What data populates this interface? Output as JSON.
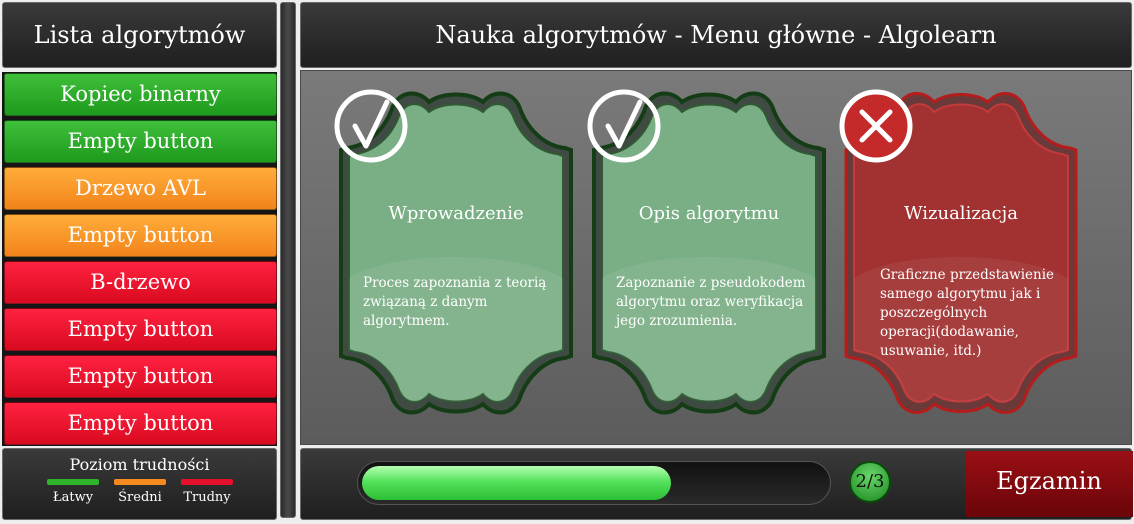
{
  "sidebar": {
    "title": "Lista algorytmów",
    "items": [
      {
        "label": "Kopiec binarny",
        "level": "easy"
      },
      {
        "label": "Empty button",
        "level": "easy"
      },
      {
        "label": "Drzewo AVL",
        "level": "medium"
      },
      {
        "label": "Empty button",
        "level": "medium"
      },
      {
        "label": "B-drzewo",
        "level": "hard"
      },
      {
        "label": "Empty button",
        "level": "hard"
      },
      {
        "label": "Empty button",
        "level": "hard"
      },
      {
        "label": "Empty button",
        "level": "hard"
      }
    ],
    "legend": {
      "title": "Poziom trudności",
      "items": [
        {
          "label": "Łatwy",
          "color": "#2fb52a"
        },
        {
          "label": "Średni",
          "color": "#f58a1f"
        },
        {
          "label": "Trudny",
          "color": "#e5102a"
        }
      ]
    }
  },
  "main": {
    "title": "Nauka algorytmów - Menu główne - Algolearn",
    "cards": [
      {
        "title": "Wprowadzenie",
        "status": "completed",
        "icon": "check-icon",
        "desc_lines": [
          "Proces zapoznania z teorią",
          "związaną z danym",
          "algorytmem."
        ]
      },
      {
        "title": "Opis algorytmu",
        "status": "completed",
        "icon": "check-icon",
        "desc_lines": [
          "Zapoznanie z pseudokodem",
          "algorytmu oraz weryfikacja",
          "jego zrozumienia."
        ]
      },
      {
        "title": "Wizualizacja",
        "status": "not-completed",
        "icon": "cross-icon",
        "desc_lines": [
          "Graficzne przedstawienie",
          "samego algorytmu jak i",
          "poszczególnych",
          "operacji(dodawanie,",
          "usuwanie, itd.)"
        ]
      }
    ]
  },
  "progress": {
    "label": "2/3",
    "fraction": 0.667
  },
  "exam_button": "Egzamin",
  "colors": {
    "easy": "#2fb52a",
    "medium": "#f58a1f",
    "hard": "#e5102a",
    "card_green": "#7aaf85",
    "card_red": "#a23232"
  }
}
